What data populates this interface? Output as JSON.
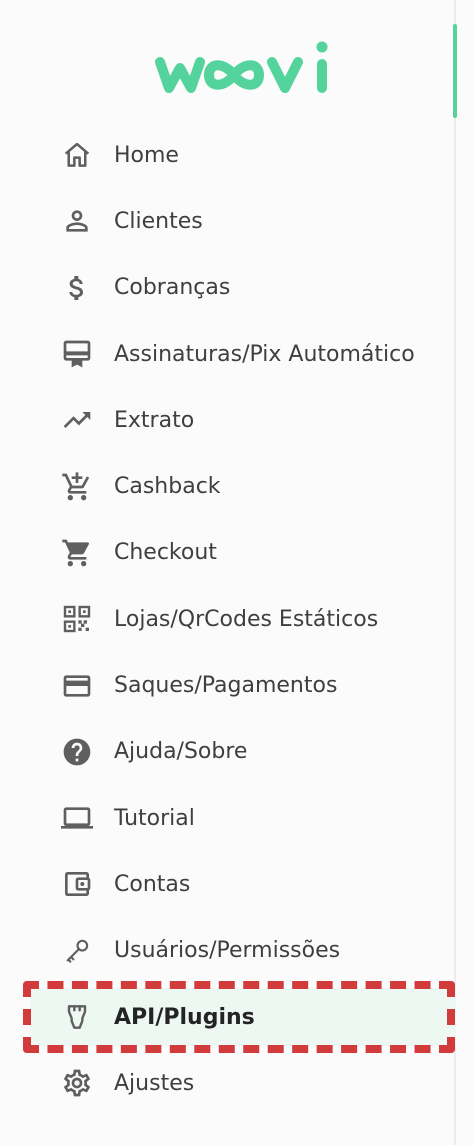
{
  "brand": {
    "name": "woovi",
    "color": "#54d49c"
  },
  "menu": {
    "items": [
      {
        "label": "Home",
        "icon": "home-icon"
      },
      {
        "label": "Clientes",
        "icon": "person-icon"
      },
      {
        "label": "Cobranças",
        "icon": "dollar-icon"
      },
      {
        "label": "Assinaturas/Pix Automático",
        "icon": "card-membership-icon"
      },
      {
        "label": "Extrato",
        "icon": "trending-up-icon"
      },
      {
        "label": "Cashback",
        "icon": "cart-add-icon"
      },
      {
        "label": "Checkout",
        "icon": "cart-icon"
      },
      {
        "label": "Lojas/QrCodes Estáticos",
        "icon": "qr-code-icon"
      },
      {
        "label": "Saques/Pagamentos",
        "icon": "credit-card-icon"
      },
      {
        "label": "Ajuda/Sobre",
        "icon": "help-icon"
      },
      {
        "label": "Tutorial",
        "icon": "laptop-icon"
      },
      {
        "label": "Contas",
        "icon": "wallet-icon"
      },
      {
        "label": "Usuários/Permissões",
        "icon": "key-icon"
      },
      {
        "label": "API/Plugins",
        "icon": "plug-icon",
        "active": true
      },
      {
        "label": "Ajustes",
        "icon": "gear-icon"
      }
    ]
  },
  "colors": {
    "active_background": "#eef8f3",
    "highlight_outline": "#d23b3b",
    "icon": "#5f5f5f",
    "text": "#3f3f3f"
  }
}
